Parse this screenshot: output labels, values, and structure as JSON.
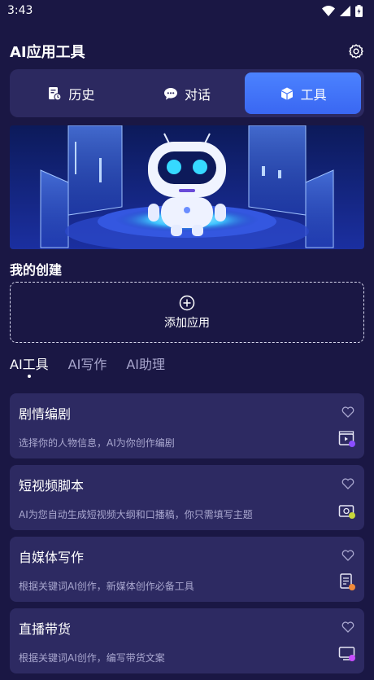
{
  "status": {
    "time": "3:43"
  },
  "header": {
    "title": "AI应用工具"
  },
  "segments": [
    {
      "label": "历史",
      "icon": "history-icon"
    },
    {
      "label": "对话",
      "icon": "chat-icon"
    },
    {
      "label": "工具",
      "icon": "box-icon",
      "active": true
    }
  ],
  "section": {
    "title": "我的创建",
    "add_label": "添加应用"
  },
  "tabs": [
    {
      "label": "AI工具",
      "active": true
    },
    {
      "label": "AI写作"
    },
    {
      "label": "AI助理"
    }
  ],
  "cards": [
    {
      "title": "剧情编剧",
      "desc": "选择你的人物信息，AI为你创作编剧",
      "icon": "clapperboard-icon",
      "badge_color": "#8a4dff"
    },
    {
      "title": "短视频脚本",
      "desc": "AI为您自动生成短视频大纲和口播稿，你只需填写主题",
      "icon": "video-camera-icon",
      "badge_color": "#c8d63a"
    },
    {
      "title": "自媒体写作",
      "desc": "根据关键词AI创作，新媒体创作必备工具",
      "icon": "notebook-icon",
      "badge_color": "#f08a3a"
    },
    {
      "title": "直播带货",
      "desc": "根据关键词AI创作，编写带货文案",
      "icon": "live-screen-icon",
      "badge_color": "#c84dff"
    }
  ],
  "colors": {
    "accent": "#4b82ff",
    "background": "#1a1744",
    "card": "#2d2a62"
  }
}
